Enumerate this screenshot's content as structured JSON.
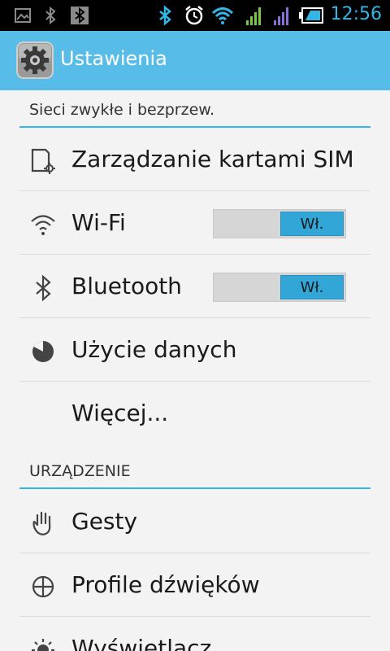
{
  "status_bar": {
    "time": "12:56",
    "icons": [
      "image-icon",
      "bluetooth-small-icon",
      "bluetooth-box-icon",
      "bluetooth-icon",
      "alarm-icon",
      "wifi-icon",
      "signal-green-icon",
      "signal-purple-icon",
      "battery-icon"
    ]
  },
  "action_bar": {
    "title": "Ustawienia",
    "icon": "settings-gear-icon"
  },
  "sections": [
    {
      "header": "Sieci zwykłe i bezprzew.",
      "items": [
        {
          "label": "Zarządzanie kartami SIM",
          "icon": "sim-card-icon"
        },
        {
          "label": "Wi-Fi",
          "icon": "wifi-icon",
          "toggle": "Wł."
        },
        {
          "label": "Bluetooth",
          "icon": "bluetooth-icon",
          "toggle": "Wł."
        },
        {
          "label": "Użycie danych",
          "icon": "data-usage-icon"
        },
        {
          "label": "Więcej...",
          "icon": ""
        }
      ]
    },
    {
      "header": "URZĄDZENIE",
      "items": [
        {
          "label": "Gesty",
          "icon": "hand-gesture-icon"
        },
        {
          "label": "Profile dźwięków",
          "icon": "sound-profile-icon"
        },
        {
          "label": "Wyświetlacz",
          "icon": "brightness-icon"
        }
      ]
    }
  ],
  "colors": {
    "accent": "#33b5e5",
    "action_bar": "#57bde8",
    "toggle_on": "#33a6d8",
    "background": "#f3f3f3"
  }
}
